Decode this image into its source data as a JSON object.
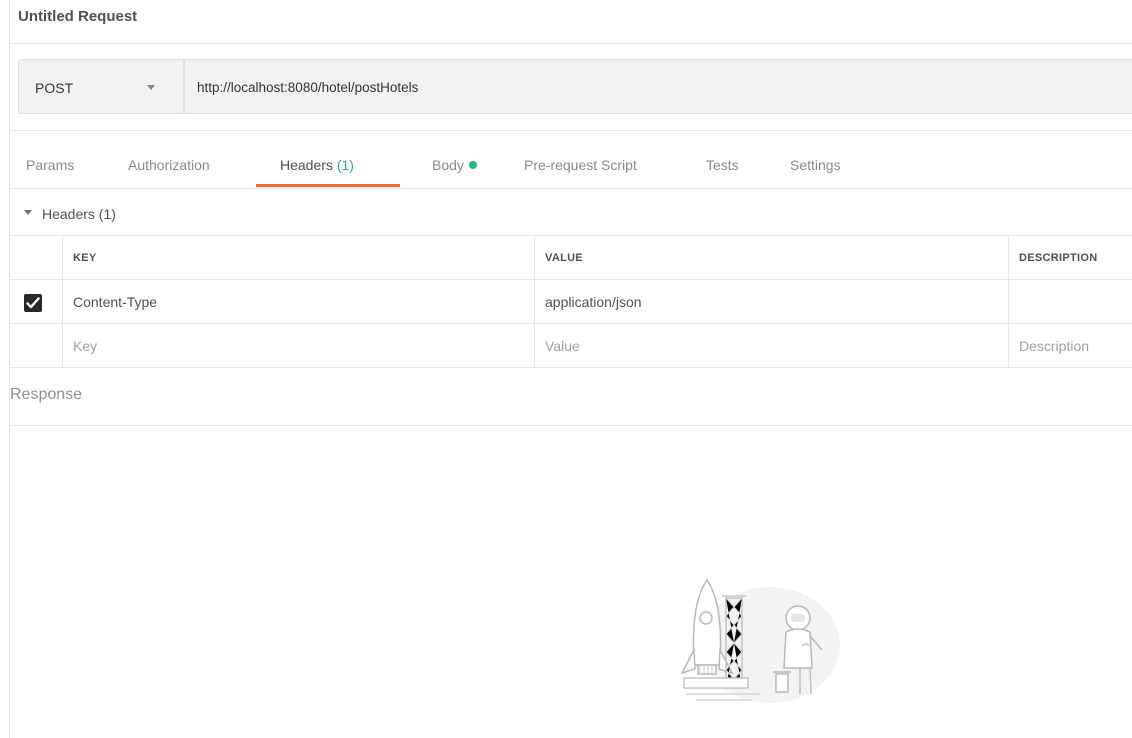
{
  "title": "Untitled Request",
  "request": {
    "method": "POST",
    "url": "http://localhost:8080/hotel/postHotels"
  },
  "tabs": [
    {
      "label": "Params"
    },
    {
      "label": "Authorization"
    },
    {
      "label": "Headers",
      "count": "(1)",
      "active": true
    },
    {
      "label": "Body",
      "status": "has-content"
    },
    {
      "label": "Pre-request Script"
    },
    {
      "label": "Tests"
    },
    {
      "label": "Settings"
    }
  ],
  "headers_section": {
    "label": "Headers (1)",
    "columns": {
      "key": "KEY",
      "value": "VALUE",
      "description": "DESCRIPTION"
    },
    "rows": [
      {
        "checked": true,
        "key": "Content-Type",
        "value": "application/json",
        "description": ""
      }
    ],
    "placeholders": {
      "key": "Key",
      "value": "Value",
      "description": "Description"
    }
  },
  "response": {
    "label": "Response"
  },
  "colors": {
    "accent": "#f26b3a",
    "green": "#26b47f"
  }
}
